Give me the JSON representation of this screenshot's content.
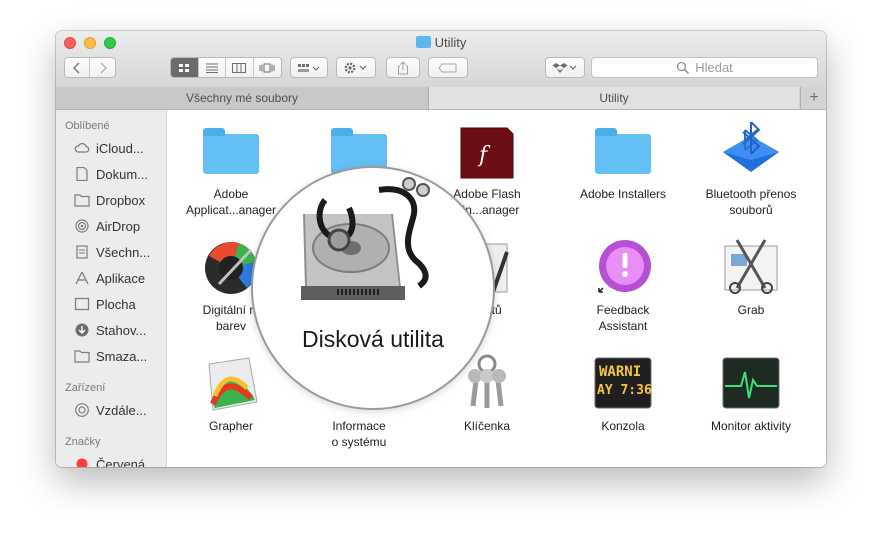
{
  "window": {
    "title": "Utility",
    "search_placeholder": "Hledat"
  },
  "tabs": [
    {
      "label": "Všechny mé soubory"
    },
    {
      "label": "Utility"
    }
  ],
  "tab_add_label": "+",
  "sidebar": {
    "favorites_header": "Oblíbené",
    "favorites": [
      {
        "label": "iCloud...",
        "icon": "cloud-icon"
      },
      {
        "label": "Dokum...",
        "icon": "document-icon"
      },
      {
        "label": "Dropbox",
        "icon": "folder-icon"
      },
      {
        "label": "AirDrop",
        "icon": "airdrop-icon"
      },
      {
        "label": "Všechn...",
        "icon": "all-files-icon"
      },
      {
        "label": "Aplikace",
        "icon": "applications-icon"
      },
      {
        "label": "Plocha",
        "icon": "desktop-icon"
      },
      {
        "label": "Stahov...",
        "icon": "downloads-icon"
      },
      {
        "label": "Smaza...",
        "icon": "folder-icon"
      }
    ],
    "devices_header": "Zařízení",
    "devices": [
      {
        "label": "Vzdále...",
        "icon": "disc-icon"
      }
    ],
    "tags_header": "Značky",
    "tags": [
      {
        "label": "Červená",
        "color": "#fc3d39"
      }
    ]
  },
  "items": [
    {
      "label": "Adobe Applicat...anager",
      "line1": "Adobe",
      "line2": "Applicat...anager",
      "icon": "folder-icon"
    },
    {
      "label": "",
      "line1": "",
      "line2": "",
      "icon": "folder-icon"
    },
    {
      "label": "Adobe Flash Player In...anager",
      "line1": "Adobe Flash",
      "line2": "r In...anager",
      "icon": "flash-icon"
    },
    {
      "label": "Adobe Installers",
      "line1": "Adobe Installers",
      "line2": "",
      "icon": "folder-icon"
    },
    {
      "label": "Bluetooth přenos souborů",
      "line1": "Bluetooth přenos",
      "line2": "souborů",
      "icon": "bluetooth-icon"
    },
    {
      "label": "Digitální měřič barev",
      "line1": "Digitální m",
      "line2": "barev",
      "icon": "color-meter-icon"
    },
    {
      "label": "",
      "line1": "",
      "line2": "",
      "icon": "disk-utility-icon"
    },
    {
      "label": "Editor skriptů",
      "line1": "kriptů",
      "line2": "",
      "icon": "script-editor-icon"
    },
    {
      "label": "Feedback Assistant",
      "line1": "Feedback",
      "line2": "Assistant",
      "icon": "feedback-icon"
    },
    {
      "label": "Grab",
      "line1": "Grab",
      "line2": "",
      "icon": "grab-icon"
    },
    {
      "label": "Grapher",
      "line1": "Grapher",
      "line2": "",
      "icon": "grapher-icon"
    },
    {
      "label": "Informace o systému",
      "line1": "Informace",
      "line2": "o systému",
      "icon": "system-info-icon"
    },
    {
      "label": "Klíčenka",
      "line1": "Klíčenka",
      "line2": "",
      "icon": "keychain-icon"
    },
    {
      "label": "Konzola",
      "line1": "Konzola",
      "line2": "",
      "icon": "console-icon"
    },
    {
      "label": "Monitor aktivity",
      "line1": "Monitor aktivity",
      "line2": "",
      "icon": "activity-monitor-icon"
    }
  ],
  "console_icon_text": {
    "line1": "WARNI",
    "line2": "AY 7:36"
  },
  "magnifier": {
    "label": "Disková utilita",
    "icon": "disk-utility-icon"
  }
}
